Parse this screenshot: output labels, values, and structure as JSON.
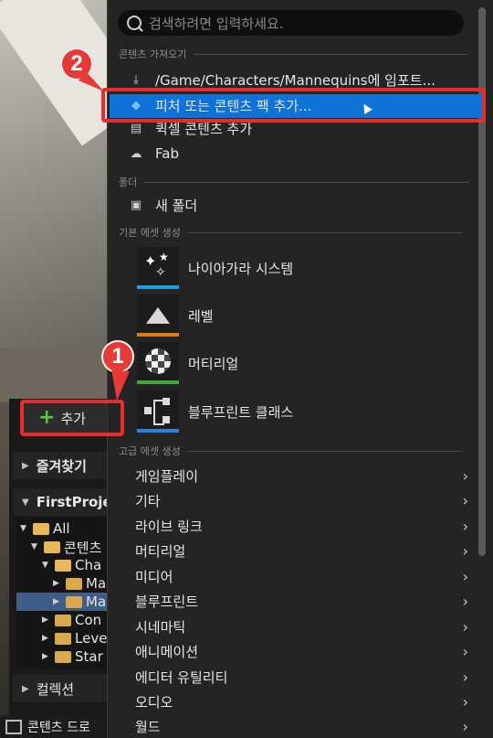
{
  "content_browser": {
    "add_label": "추가",
    "favorites": "즐겨찾기",
    "project": "FirstProje",
    "collections": "컬렉션",
    "status": "콘텐츠 드로",
    "tree": [
      {
        "label": "All"
      },
      {
        "label": "콘텐츠"
      },
      {
        "label": "Cha"
      },
      {
        "label": "Ma"
      },
      {
        "label": "Ma"
      },
      {
        "label": "Con"
      },
      {
        "label": "Leve"
      },
      {
        "label": "Star"
      }
    ]
  },
  "annotations": {
    "one": "1",
    "two": "2"
  },
  "menu": {
    "search_placeholder": "검색하려면 입력하세요.",
    "section_import": "콘텐츠 가져오기",
    "import_items": [
      {
        "label": "/Game/Characters/Mannequins에 임포트...",
        "icon": "import-icon"
      },
      {
        "label": "피처 또는 콘텐츠 팩 추가...",
        "icon": "feature-pack-icon"
      },
      {
        "label": "퀵셀 콘텐츠 추가",
        "icon": "quixel-icon"
      },
      {
        "label": "Fab",
        "icon": "fab-icon"
      }
    ],
    "section_folder": "폴더",
    "new_folder": "새 폴더",
    "section_basic": "기본 에셋 생성",
    "basic_assets": [
      {
        "label": "나이아가라 시스템",
        "icon": "niagara-icon",
        "color": "#1aa0e0"
      },
      {
        "label": "레벨",
        "icon": "level-icon",
        "color": "#e07a1a"
      },
      {
        "label": "머티리얼",
        "icon": "material-icon",
        "color": "#3fa83f"
      },
      {
        "label": "블루프린트 클래스",
        "icon": "blueprint-icon",
        "color": "#2a7fe0"
      }
    ],
    "section_advanced": "고급 에셋 생성",
    "advanced_items": [
      {
        "label": "게임플레이"
      },
      {
        "label": "기타"
      },
      {
        "label": "라이브 링크"
      },
      {
        "label": "머티리얼"
      },
      {
        "label": "미디어"
      },
      {
        "label": "블루프린트"
      },
      {
        "label": "시네마틱"
      },
      {
        "label": "애니메이션"
      },
      {
        "label": "에디터 유틸리티"
      },
      {
        "label": "오디오"
      },
      {
        "label": "월드"
      }
    ]
  },
  "colors": {
    "highlight": "#0f72d8",
    "annotation": "#e82c2c",
    "add_plus": "#58c838"
  }
}
